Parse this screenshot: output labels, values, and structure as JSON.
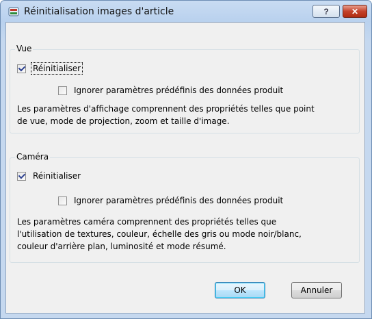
{
  "window": {
    "title": "Réinitialisation images d'article",
    "help_label": "?",
    "close_label": "✕"
  },
  "vue": {
    "legend": "Vue",
    "reset_label": "Réinitialiser",
    "reset_checked": true,
    "ignore_label": "Ignorer paramètres prédéfinis des données produit",
    "ignore_checked": false,
    "description_lines": [
      "Les paramètres d'affichage comprennent des propriétés telles que point",
      "de vue, mode de projection, zoom et taille d'image."
    ]
  },
  "camera": {
    "legend": "Caméra",
    "reset_label": "Réinitialiser",
    "reset_checked": true,
    "ignore_label": "Ignorer paramètres prédéfinis des données produit",
    "ignore_checked": false,
    "description_lines": [
      "Les paramètres caméra comprennent des propriétés telles que",
      "l'utilisation de textures, couleur, échelle des gris ou mode noir/blanc,",
      "couleur d'arrière plan, luminosité et mode résumé."
    ]
  },
  "buttons": {
    "ok_label": "OK",
    "cancel_label": "Annuler"
  }
}
